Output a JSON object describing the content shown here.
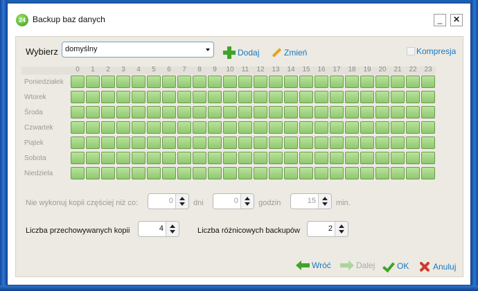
{
  "window": {
    "title": "Backup baz danych",
    "logo_text": "24",
    "minimize": "_",
    "close": "✕"
  },
  "toolbar": {
    "choose_label": "Wybierz",
    "profile_value": "domyślny",
    "add_label": "Dodaj",
    "edit_label": "Zmień",
    "compress_label": "Kompresja"
  },
  "schedule": {
    "hours": [
      "0",
      "1",
      "2",
      "3",
      "4",
      "5",
      "6",
      "7",
      "8",
      "9",
      "10",
      "11",
      "12",
      "13",
      "14",
      "15",
      "16",
      "17",
      "18",
      "19",
      "20",
      "21",
      "22",
      "23"
    ],
    "days": [
      "Poniedziałek",
      "Wtorek",
      "Środa",
      "Czwartek",
      "Piątek",
      "Sobota",
      "Niedziela"
    ]
  },
  "frequency": {
    "label": "Nie wykonuj kopii częściej niż co:",
    "days_value": "0",
    "days_unit": "dni",
    "hours_value": "0",
    "hours_unit": "godzin",
    "minutes_value": "15",
    "minutes_unit": "min."
  },
  "storage": {
    "copies_label": "Liczba przechowywanych kopii",
    "copies_value": "4",
    "diff_label": "Liczba różnicowych backupów",
    "diff_value": "2"
  },
  "footer": {
    "back": "Wróć",
    "next": "Dalej",
    "ok": "OK",
    "cancel": "Anuluj"
  },
  "colors": {
    "accent": "#1a76c4",
    "cell": "#a3d585",
    "frame": "#1d5fb3"
  }
}
